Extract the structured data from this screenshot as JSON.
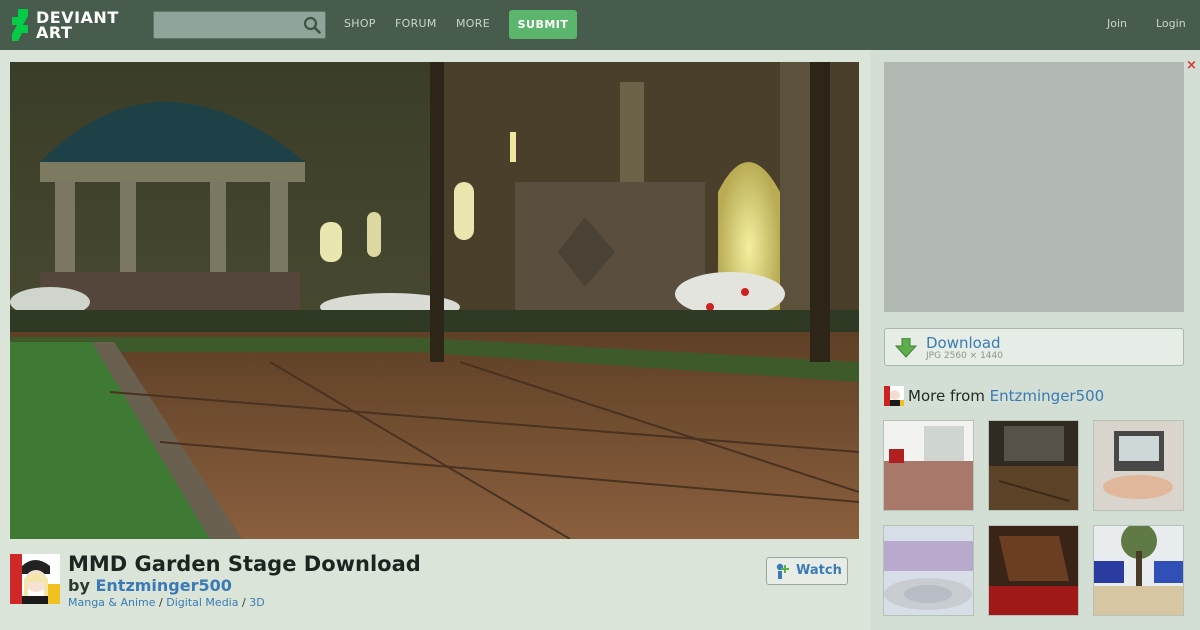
{
  "header": {
    "logo_line1": "DEVIANT",
    "logo_line2": "ART",
    "search_placeholder": "",
    "nav": {
      "shop": "SHOP",
      "forum": "FORUM",
      "more": "MORE"
    },
    "submit_label": "SUBMIT",
    "join_label": "Join",
    "login_label": "Login"
  },
  "deviation": {
    "title": "MMD Garden Stage Download",
    "by_prefix": "by",
    "author": "Entzminger500",
    "categories": [
      "Manga & Anime",
      "Digital Media",
      "3D"
    ],
    "category_separator": "/",
    "watch_label": "Watch"
  },
  "sidebar": {
    "ad_close": "×",
    "download": {
      "label": "Download",
      "meta": "JPG 2560 × 1440"
    },
    "more_from": {
      "prefix": "More from",
      "user": "Entzminger500"
    }
  },
  "icons": [
    "deviantart-logo-icon",
    "search-icon",
    "download-arrow-icon",
    "watch-icon",
    "user-avatar-icon"
  ],
  "colors": {
    "topbar": "#475c4d",
    "background": "#dae4d9",
    "submit": "#5cb56c",
    "link": "#3a7bb5",
    "ad_close": "#dd3333"
  }
}
